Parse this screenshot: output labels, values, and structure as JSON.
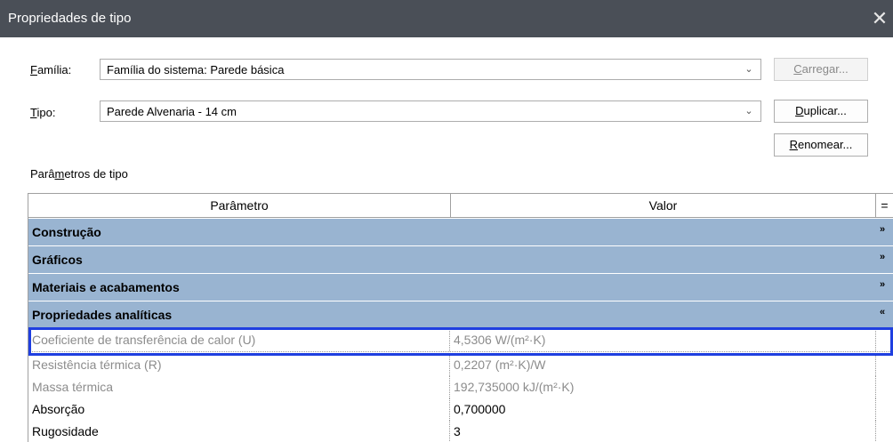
{
  "window": {
    "title": "Propriedades de tipo",
    "close_icon": "close-icon"
  },
  "familia": {
    "label_first": "F",
    "label_rest": "amília:",
    "value": "Família do sistema: Parede básica"
  },
  "tipo": {
    "label_first": "T",
    "label_rest": "ipo:",
    "value": "Parede Alvenaria - 14 cm"
  },
  "buttons": {
    "carregar": {
      "first": "C",
      "rest": "arregar..."
    },
    "duplicar": {
      "first": "D",
      "rest": "uplicar..."
    },
    "renomear": {
      "first": "R",
      "rest": "enomear..."
    }
  },
  "params_label": {
    "before": "Parâ",
    "mnemonic": "m",
    "after": "etros de tipo"
  },
  "table": {
    "header": {
      "param": "Parâmetro",
      "value": "Valor",
      "menu": "="
    },
    "groups": [
      {
        "name": "Construção",
        "expanded": false
      },
      {
        "name": "Gráficos",
        "expanded": false
      },
      {
        "name": "Materiais e acabamentos",
        "expanded": false
      },
      {
        "name": "Propriedades analíticas",
        "expanded": true
      }
    ],
    "rows": [
      {
        "param": "Coeficiente de transferência de calor (U)",
        "value": "4,5306 W/(m²·K)",
        "readonly": true
      },
      {
        "param": "Resistência térmica (R)",
        "value": "0,2207 (m²·K)/W",
        "readonly": true
      },
      {
        "param": "Massa térmica",
        "value": "192,735000 kJ/(m²·K)",
        "readonly": true
      },
      {
        "param": "Absorção",
        "value": "0,700000",
        "readonly": false
      },
      {
        "param": "Rugosidade",
        "value": "3",
        "readonly": false
      }
    ]
  },
  "colors": {
    "title_bar": "#4a4f57",
    "group_row": "#99b4d1",
    "highlight": "#1f3fe0"
  }
}
